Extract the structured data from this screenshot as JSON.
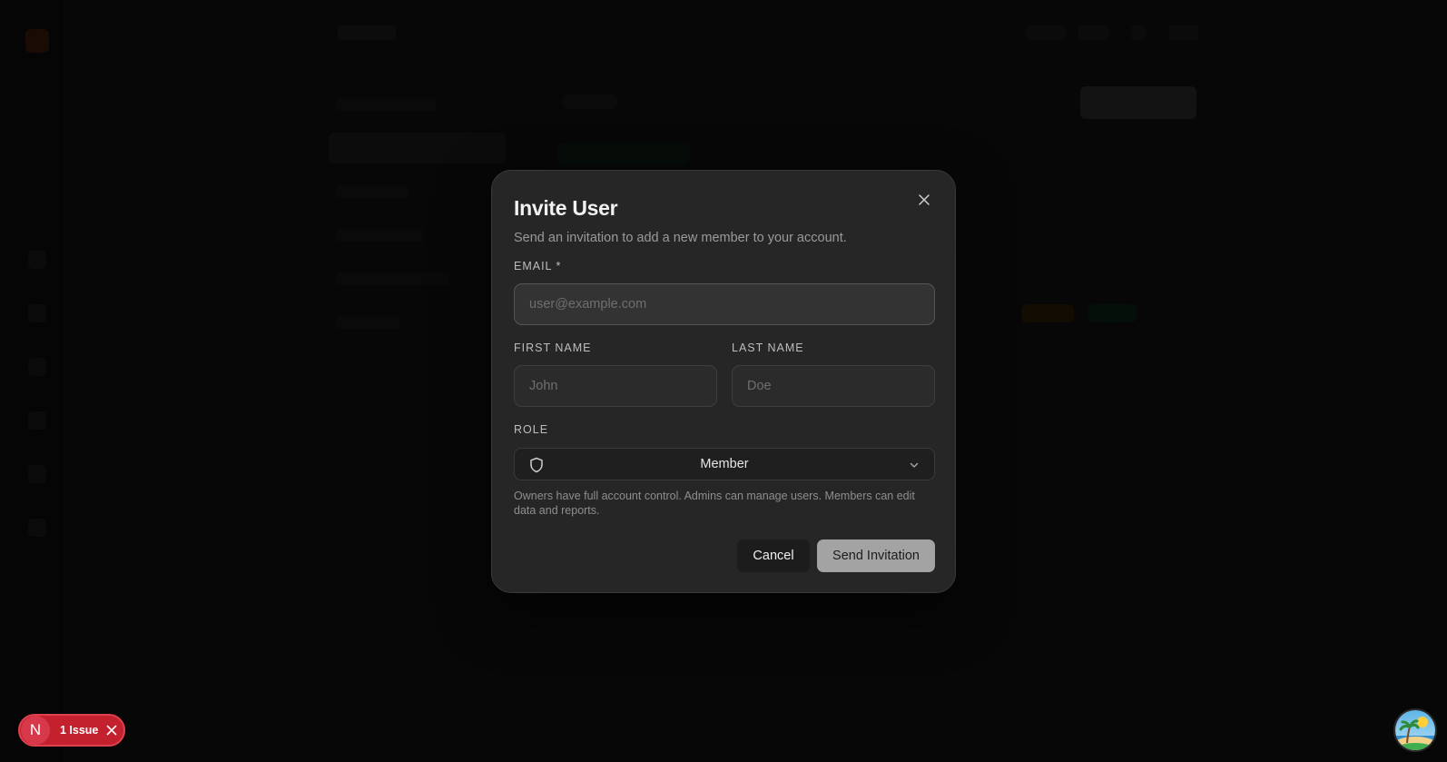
{
  "modal": {
    "title": "Invite User",
    "subtitle": "Send an invitation to add a new member to your account.",
    "email": {
      "label": "EMAIL *",
      "placeholder": "user@example.com",
      "value": ""
    },
    "first_name": {
      "label": "FIRST NAME",
      "placeholder": "John",
      "value": ""
    },
    "last_name": {
      "label": "LAST NAME",
      "placeholder": "Doe",
      "value": ""
    },
    "role": {
      "label": "ROLE",
      "selected": "Member",
      "hint": "Owners have full account control. Admins can manage users. Members can edit data and reports."
    },
    "buttons": {
      "cancel": "Cancel",
      "send": "Send Invitation"
    }
  },
  "dev_overlay": {
    "logo_letter": "N",
    "issues_label": "1 Issue"
  },
  "colors": {
    "modal_bg": "#262626",
    "send_button_bg": "#a3a3a3",
    "issue_badge_bg": "#c4212f"
  },
  "icons": {
    "close": "close-icon",
    "role": "shield-icon",
    "dropdown": "chevron-down-icon",
    "dismiss_issue": "close-icon"
  }
}
